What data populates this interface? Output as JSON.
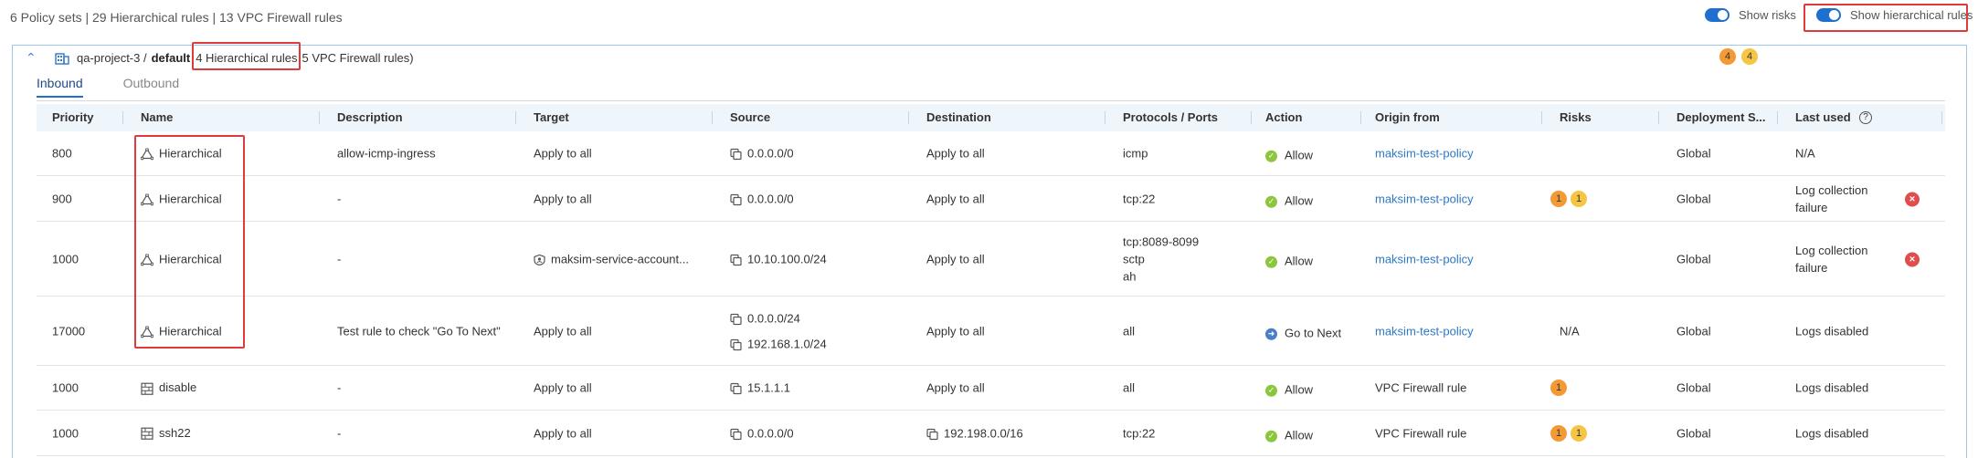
{
  "summary": "6 Policy sets | 29 Hierarchical rules | 13 VPC Firewall rules",
  "toggles": {
    "show_risks": "Show risks",
    "show_hierarchical": "Show hierarchical rules"
  },
  "project": {
    "name": "qa-project-3 /",
    "network": "default",
    "hier_count": "4 Hierarchical rules",
    "vpc_count": "5 VPC Firewall rules)",
    "badges": [
      "4",
      "4"
    ]
  },
  "tabs": [
    "Inbound",
    "Outbound"
  ],
  "columns": [
    "Priority",
    "Name",
    "Description",
    "Target",
    "Source",
    "Destination",
    "Protocols / Ports",
    "Action",
    "Origin from",
    "Risks",
    "Deployment S...",
    "Last used"
  ],
  "rows": [
    {
      "priority": "800",
      "name": "Hierarchical",
      "type": "hier",
      "description": "allow-icmp-ingress",
      "target": "Apply to all",
      "source": [
        "0.0.0.0/0"
      ],
      "destination": "Apply to all",
      "protocols": [
        "icmp"
      ],
      "action": "Allow",
      "origin": "maksim-test-policy",
      "origin_link": true,
      "risks": [],
      "risks_text": "",
      "deployment": "Global",
      "last_used": [
        "N/A"
      ],
      "error": false
    },
    {
      "priority": "900",
      "name": "Hierarchical",
      "type": "hier",
      "description": "-",
      "target": "Apply to all",
      "source": [
        "0.0.0.0/0"
      ],
      "destination": "Apply to all",
      "protocols": [
        "tcp:22"
      ],
      "action": "Allow",
      "origin": "maksim-test-policy",
      "origin_link": true,
      "risks": [
        "1",
        "1"
      ],
      "risks_text": "",
      "deployment": "Global",
      "last_used": [
        "Log collection",
        "failure"
      ],
      "error": true
    },
    {
      "priority": "1000",
      "name": "Hierarchical",
      "type": "hier",
      "description": "-",
      "target": "maksim-service-account...",
      "target_icon": true,
      "source": [
        "10.10.100.0/24"
      ],
      "destination": "Apply to all",
      "protocols": [
        "tcp:8089-8099",
        "sctp",
        "ah"
      ],
      "action": "Allow",
      "origin": "maksim-test-policy",
      "origin_link": true,
      "risks": [],
      "risks_text": "",
      "deployment": "Global",
      "last_used": [
        "Log collection",
        "failure"
      ],
      "error": true
    },
    {
      "priority": "17000",
      "name": "Hierarchical",
      "type": "hier",
      "description": "Test rule to check \"Go To Next\"",
      "target": "Apply to all",
      "source": [
        "0.0.0.0/24",
        "192.168.1.0/24"
      ],
      "destination": "Apply to all",
      "protocols": [
        "all"
      ],
      "action": "Go to Next",
      "action_next": true,
      "origin": "maksim-test-policy",
      "origin_link": true,
      "risks": [],
      "risks_text": "N/A",
      "deployment": "Global",
      "last_used": [
        "Logs disabled"
      ],
      "error": false
    },
    {
      "priority": "1000",
      "name": "disable",
      "type": "vpc",
      "description": "-",
      "target": "Apply to all",
      "source": [
        "15.1.1.1"
      ],
      "destination": "Apply to all",
      "protocols": [
        "all"
      ],
      "action": "Allow",
      "origin": "VPC Firewall rule",
      "origin_link": false,
      "risks": [
        "1"
      ],
      "risks_text": "",
      "deployment": "Global",
      "last_used": [
        "Logs disabled"
      ],
      "error": false
    },
    {
      "priority": "1000",
      "name": "ssh22",
      "type": "vpc",
      "description": "-",
      "target": "Apply to all",
      "source": [
        "0.0.0.0/0"
      ],
      "destination": "192.198.0.0/16",
      "dest_icon": true,
      "protocols": [
        "tcp:22"
      ],
      "action": "Allow",
      "origin": "VPC Firewall rule",
      "origin_link": false,
      "risks": [
        "1",
        "1"
      ],
      "risks_text": "",
      "deployment": "Global",
      "last_used": [
        "Logs disabled"
      ],
      "error": false
    }
  ],
  "colors": {
    "accent": "#1f6fd1",
    "link": "#2f78c4",
    "highlight": "#e03a3a",
    "risk_orange": "#f39a37",
    "risk_yellow": "#f6c544",
    "allow": "#8cc63f",
    "error": "#e04d4d"
  },
  "icons": {
    "hier": "hierarchy-icon",
    "vpc": "firewall-icon",
    "project": "building-icon",
    "copy": "copy-icon",
    "help": "help-circle-icon"
  }
}
